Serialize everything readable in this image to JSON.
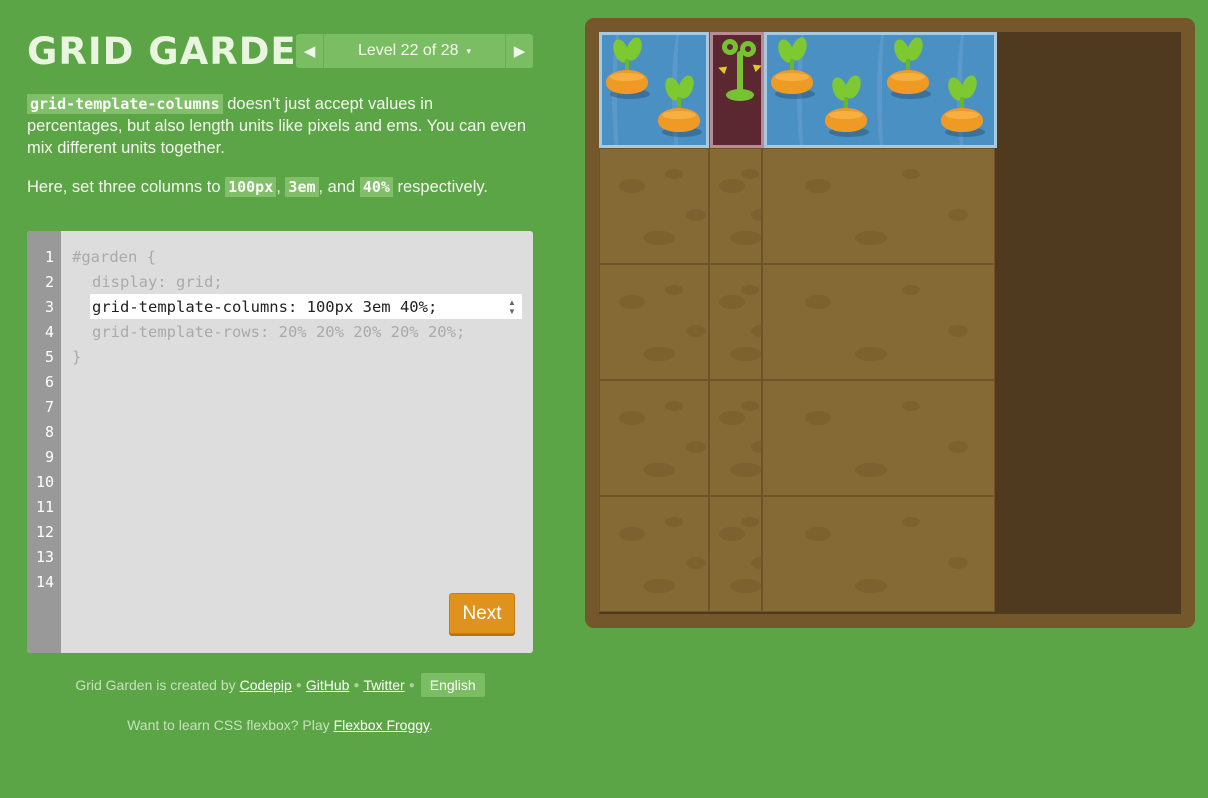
{
  "app": {
    "title": "GRID GARDEN",
    "level_label": "Level 22 of 28",
    "prev_icon": "◀",
    "next_icon": "▶",
    "caret_icon": "▾"
  },
  "instructions": {
    "p1_code": "grid-template-columns",
    "p1_text": " doesn't just accept values in percentages, but also length units like pixels and ems. You can even mix different units together.",
    "p2_prefix": "Here, set three columns to ",
    "p2_code1": "100px",
    "p2_sep1": ", ",
    "p2_code2": "3em",
    "p2_sep2": ", and ",
    "p2_code3": "40%",
    "p2_suffix": " respectively."
  },
  "editor": {
    "line_numbers": [
      "1",
      "2",
      "3",
      "4",
      "5",
      "6",
      "7",
      "8",
      "9",
      "10",
      "11",
      "12",
      "13",
      "14"
    ],
    "line1": "#garden {",
    "line2": "display: grid;",
    "input_value": "grid-template-columns: 100px 3em 40%;",
    "line4": "grid-template-rows: 20% 20% 20% 20% 20%;",
    "line5": "}",
    "next_button": "Next"
  },
  "footer": {
    "created_prefix": "Grid Garden is created by",
    "codepip": "Codepip",
    "github": "GitHub",
    "twitter": "Twitter",
    "language": "English",
    "flexbox_prefix": "Want to learn CSS flexbox? Play ",
    "flexbox_link": "Flexbox Froggy",
    "flexbox_suffix": "."
  },
  "colors": {
    "background": "#5ca546",
    "next_button": "#e0921e",
    "board": "#74572a",
    "soil": "#856a35",
    "water": "#4a90c2",
    "weed_bed": "#5b2832"
  }
}
